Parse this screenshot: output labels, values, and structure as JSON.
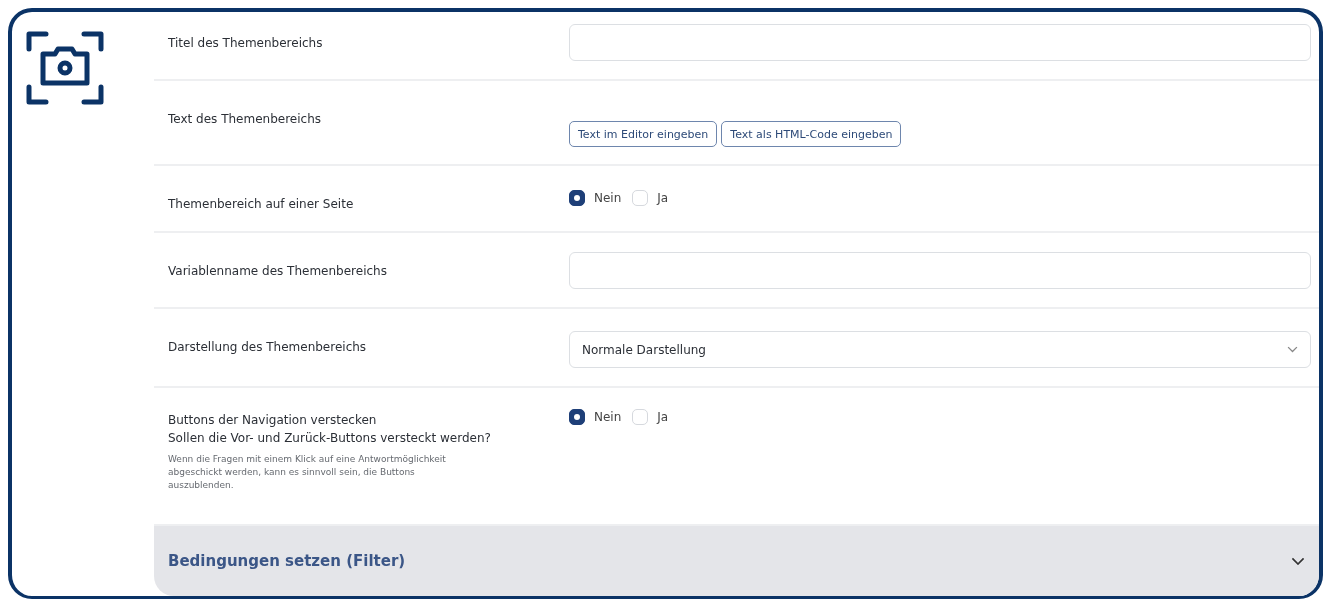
{
  "rows": [
    {
      "kind": "text",
      "label": "Titel des Themenbereichs"
    },
    {
      "kind": "editor",
      "label": "Text des Themenbereichs",
      "buttons": [
        "Text im Editor eingeben",
        "Text als HTML-Code eingeben"
      ]
    },
    {
      "kind": "radio",
      "label": "Themenbereich auf einer Seite",
      "options": [
        {
          "label": "Nein",
          "selected": true
        },
        {
          "label": "Ja",
          "selected": false
        }
      ]
    },
    {
      "kind": "text",
      "label": "Variablenname des Themenbereichs"
    },
    {
      "kind": "select",
      "label": "Darstellung des Themenbereichs",
      "value": "Normale Darstellung"
    },
    {
      "kind": "radio",
      "label": "Buttons der Navigation verstecken",
      "sublabel": "Sollen die Vor- und Zurück-Buttons versteckt werden?",
      "help": "Wenn die Fragen mit einem Klick auf eine Antwortmöglichkeit abgeschickt werden, kann es sinnvoll sein, die Buttons auszublenden.",
      "options": [
        {
          "label": "Nein",
          "selected": true
        },
        {
          "label": "Ja",
          "selected": false
        }
      ]
    }
  ],
  "section": {
    "title": "Bedingungen setzen (Filter)",
    "expanded": false
  }
}
